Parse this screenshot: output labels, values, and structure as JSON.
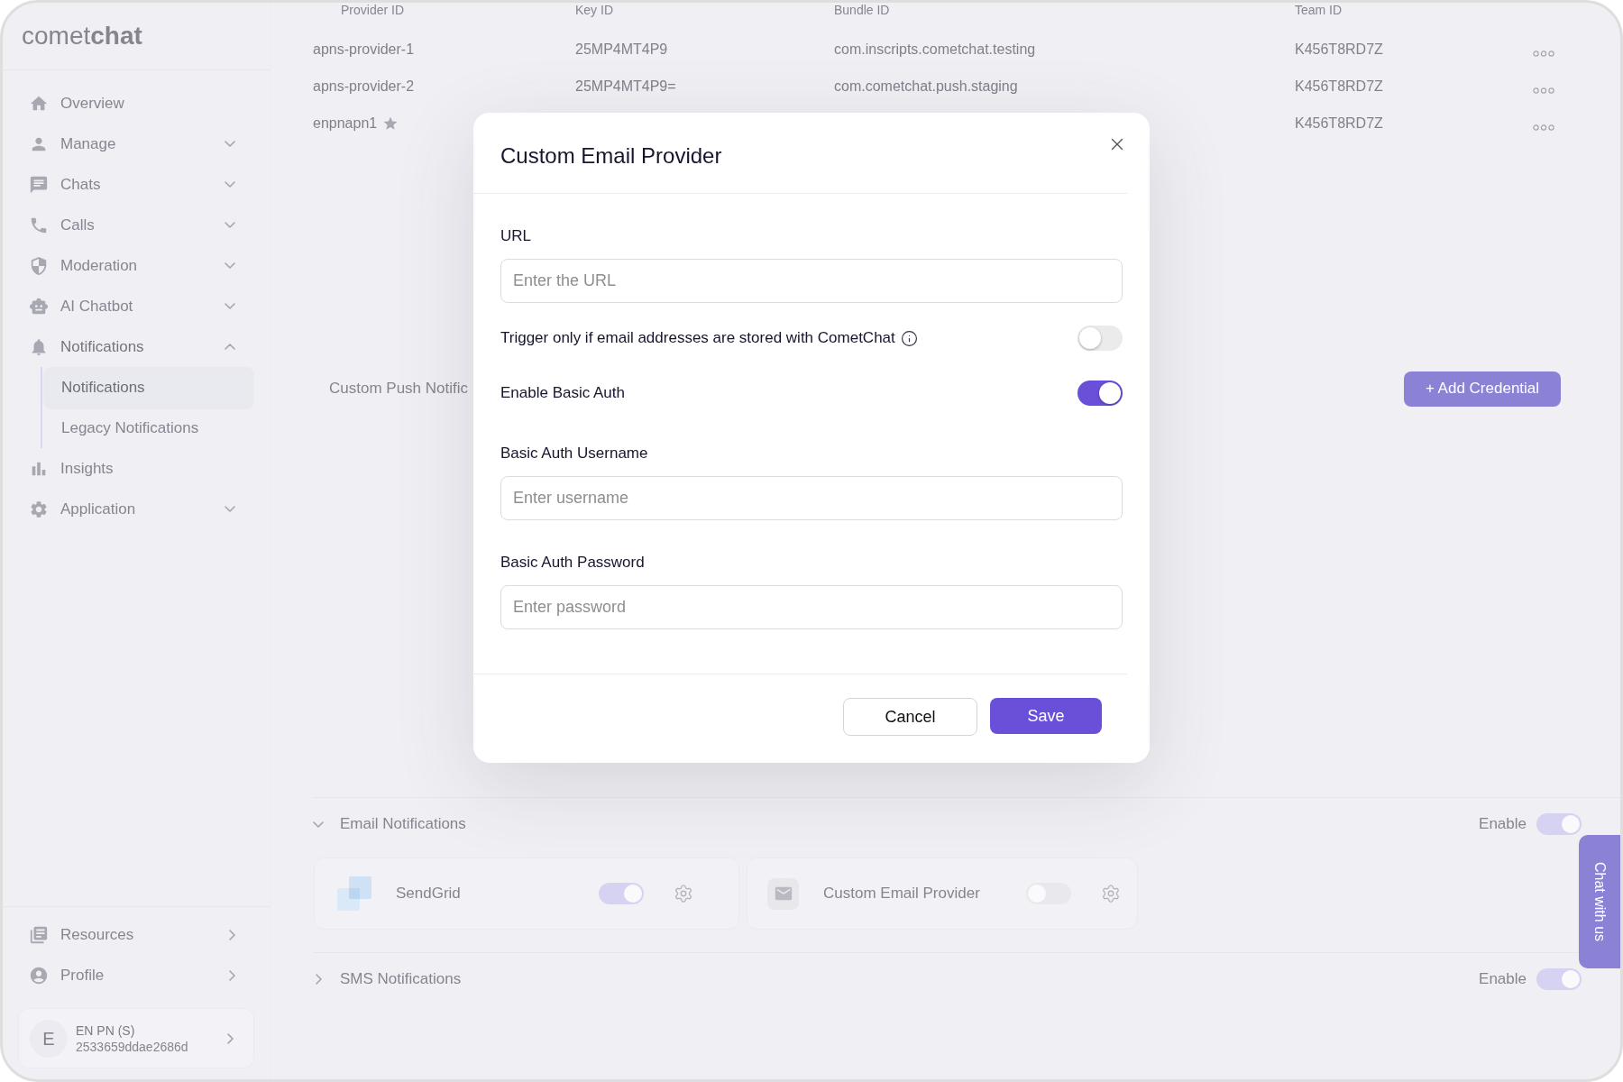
{
  "sidebar": {
    "logo": "comet**chat**",
    "items": [
      {
        "label": "Overview",
        "kind": "plain"
      },
      {
        "label": "Manage",
        "kind": "group",
        "expanded": false
      },
      {
        "label": "Chats",
        "kind": "group",
        "expanded": false
      },
      {
        "label": "Calls",
        "kind": "group",
        "expanded": false
      },
      {
        "label": "Moderation",
        "kind": "group",
        "expanded": false
      },
      {
        "label": "AI Chatbot",
        "kind": "group",
        "expanded": false
      },
      {
        "label": "Notifications",
        "kind": "group",
        "expanded": true,
        "children": [
          {
            "label": "Notifications",
            "selected": true
          },
          {
            "label": "Legacy Notifications",
            "selected": false
          }
        ]
      },
      {
        "label": "Insights",
        "kind": "plain"
      },
      {
        "label": "Application",
        "kind": "group",
        "expanded": false
      }
    ],
    "footer_items": [
      {
        "label": "Resources",
        "kind": "link"
      },
      {
        "label": "Profile",
        "kind": "link"
      }
    ],
    "account": {
      "avatar_letter": "E",
      "name": "EN PN (S)",
      "app_id": "2533659ddae2686d"
    }
  },
  "table": {
    "columns": [
      "Provider ID",
      "Key ID",
      "Bundle ID",
      "Team ID"
    ],
    "rows": [
      {
        "provider_id": "apns-provider-1",
        "key_id": "25MP4MT4P9",
        "bundle_id": "com.inscripts.cometchat.testing",
        "team_id": "K456T8RD7Z",
        "starred": false
      },
      {
        "provider_id": "apns-provider-2",
        "key_id": "25MP4MT4P9=",
        "bundle_id": "com.cometchat.push.staging",
        "team_id": "K456T8RD7Z",
        "starred": false
      },
      {
        "provider_id": "enpnapn1",
        "team_id": "K456T8RD7Z",
        "starred": true
      }
    ]
  },
  "push_section": {
    "title": "Custom Push Notific",
    "add_button": "+ Add Credential"
  },
  "sections": [
    {
      "title": "Email Notifications",
      "expanded": true,
      "enable_label": "Enable",
      "enabled": true,
      "providers": [
        {
          "name": "SendGrid",
          "on": true
        },
        {
          "name": "Custom Email Provider",
          "on": false
        }
      ]
    },
    {
      "title": "SMS Notifications",
      "expanded": false,
      "enable_label": "Enable",
      "enabled": true
    }
  ],
  "chat_widget": {
    "label": "Chat with us"
  },
  "modal": {
    "title": "Custom Email Provider",
    "fields": [
      {
        "kind": "input",
        "label": "URL",
        "placeholder": "Enter the URL"
      },
      {
        "kind": "toggle",
        "label": "Trigger only if email addresses are stored with CometChat",
        "info": true,
        "on": false
      },
      {
        "kind": "toggle",
        "label": "Enable Basic Auth",
        "on": true
      },
      {
        "kind": "input",
        "label": "Basic Auth Username",
        "placeholder": "Enter username"
      },
      {
        "kind": "input",
        "label": "Basic Auth Password",
        "placeholder": "Enter password"
      }
    ],
    "buttons": [
      {
        "label": "Cancel",
        "kind": "secondary"
      },
      {
        "label": "Save",
        "kind": "primary"
      }
    ]
  }
}
